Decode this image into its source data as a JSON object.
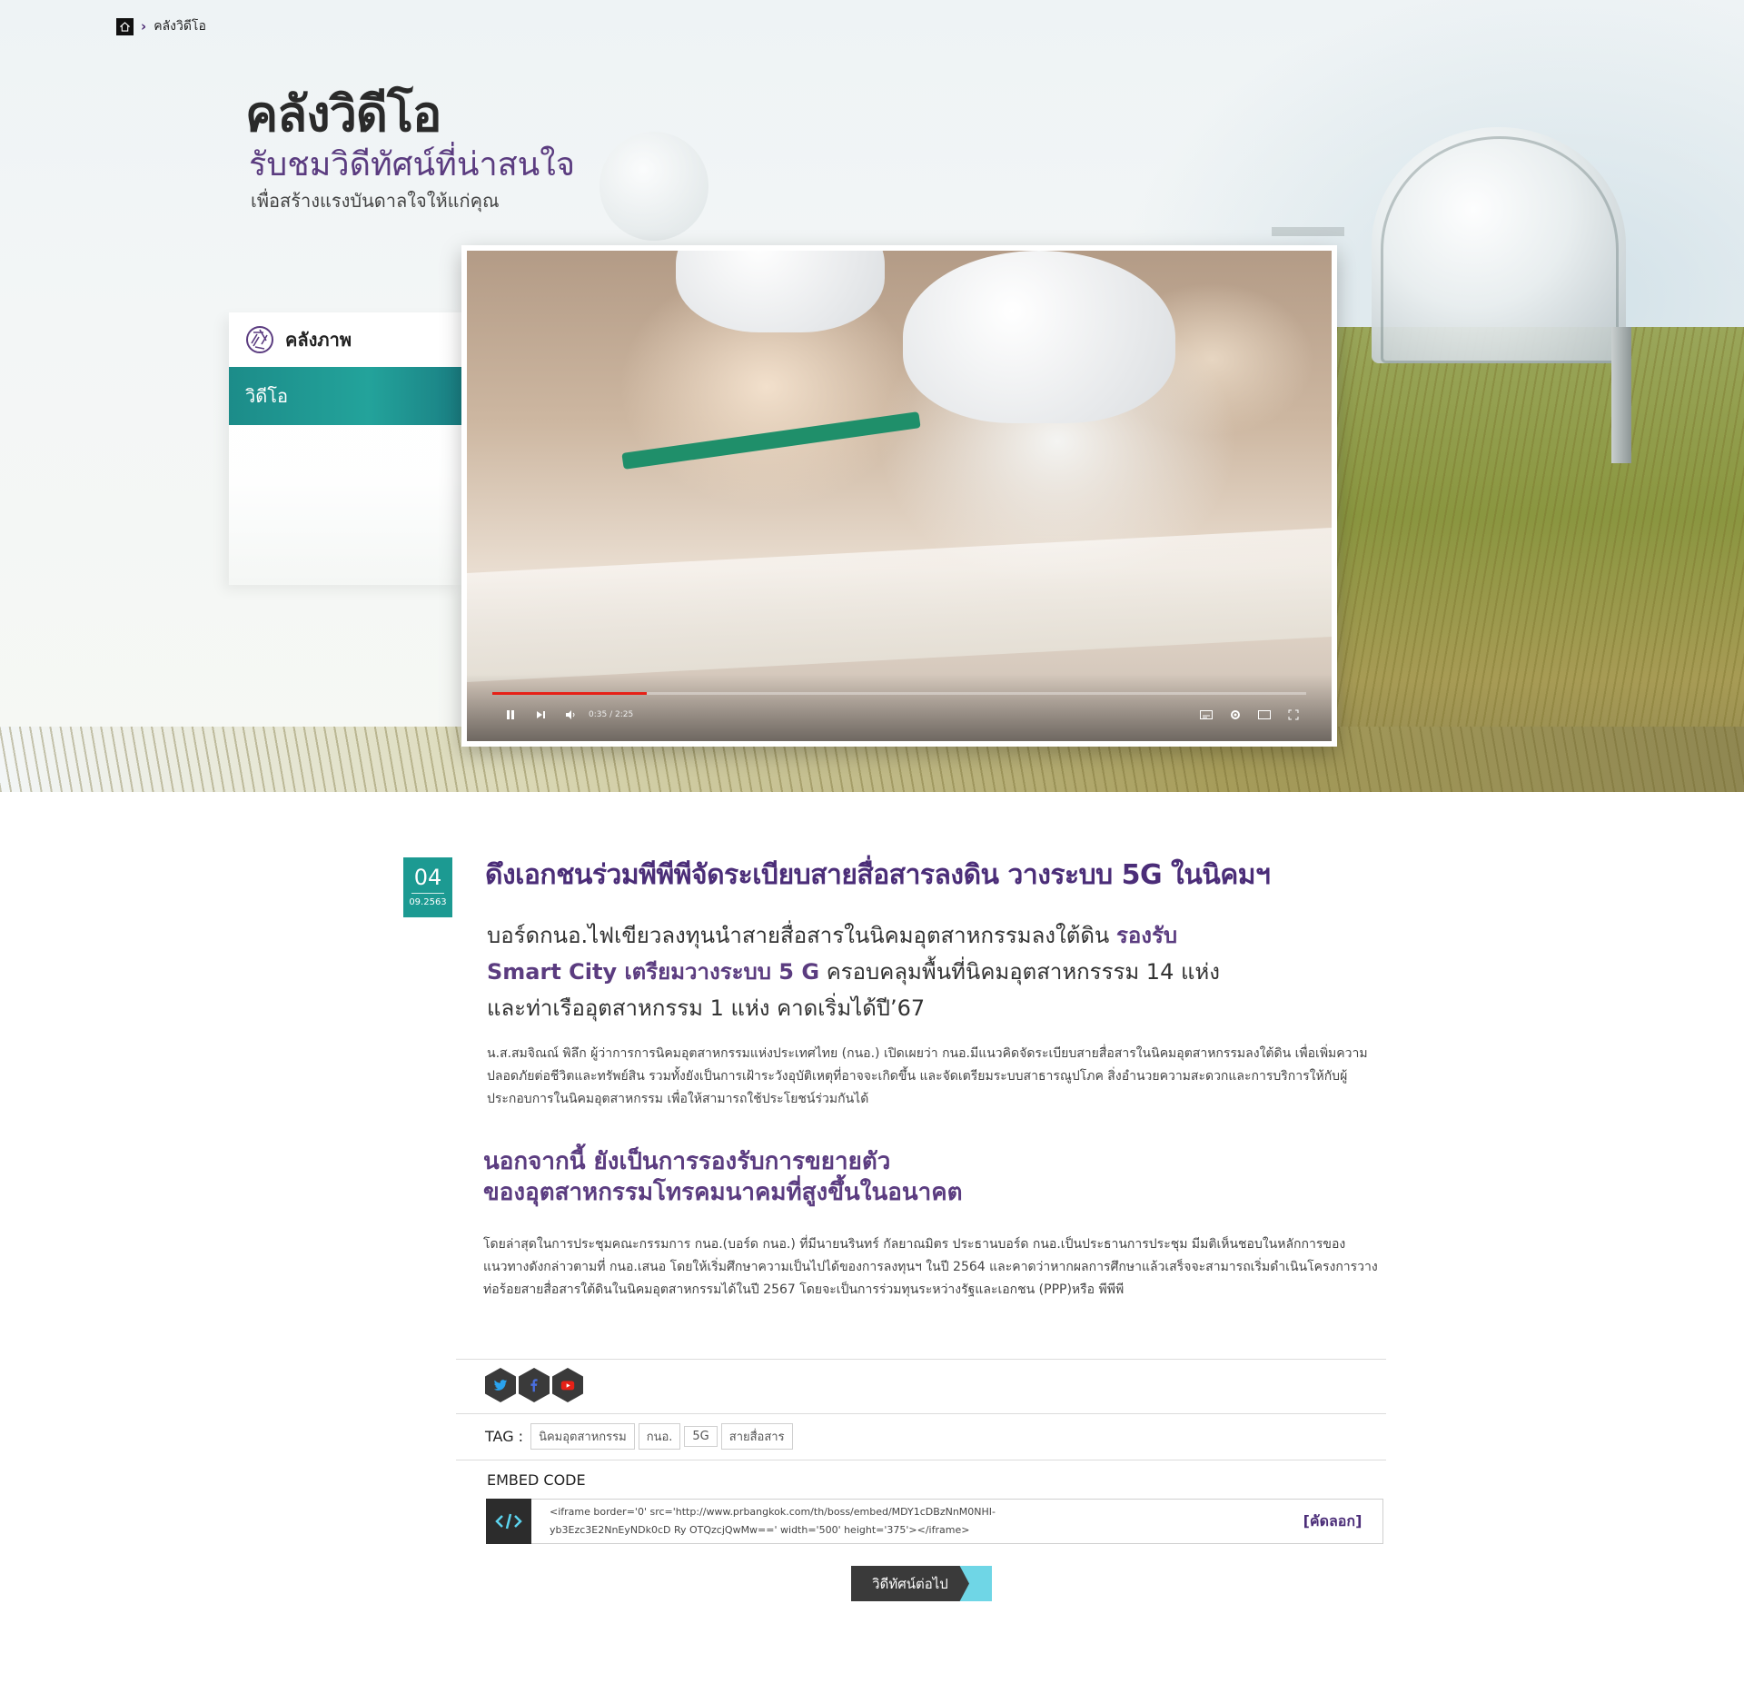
{
  "breadcrumb": {
    "current": "คลังวิดีโอ"
  },
  "header": {
    "title": "คลังวิดีโอ",
    "subtitle": "รับชมวิดีทัศน์ที่น่าสนใจ",
    "caption": "เพื่อสร้างแรงบันดาลใจให้แก่คุณ"
  },
  "sidebar": {
    "heading": "คลังภาพ",
    "items": [
      {
        "label": "วิดีโอ",
        "active": true
      }
    ]
  },
  "video": {
    "time": "0:35 / 2:25",
    "progress_fraction": 0.19,
    "icons": [
      "pause-icon",
      "next-icon",
      "volume-icon",
      "subtitles-icon",
      "settings-icon",
      "theater-icon",
      "fullscreen-icon"
    ]
  },
  "article": {
    "date_day": "04",
    "date_full": "09.2563",
    "headline": "ดึงเอกชนร่วมพีพีพีจัดระเบียบสายสื่อสารลงดิน วางระบบ 5G ในนิคมฯ",
    "lead_line1_a": "บอร์ดกนอ.ไฟเขียวลงทุนนำสายสื่อสารในนิคมอุตสาหกรรมลงใต้ดิน ",
    "lead_line1_b": "รองรับ",
    "lead_line2_a": "Smart City เตรียมวางระบบ 5 G",
    "lead_line2_b": " ครอบคลุมพื้นที่นิคมอุตสาหกรรรม 14 แห่ง",
    "lead_line3": "และท่าเรืออุตสาหกรรม 1 แห่ง คาดเริ่มได้ปี’67",
    "paragraph1": "น.ส.สมจิณณ์   พิลึก  ผู้ว่าการการนิคมอุตสาหกรรมแห่งประเทศไทย (กนอ.) เปิดเผยว่า  กนอ.มีแนวคิดจัดระเบียบสายสื่อสารในนิคมอุตสาหกรรมลงใต้ดิน เพื่อเพิ่มความปลอดภัยต่อชีวิตและทรัพย์สิน รวมทั้งยังเป็นการเฝ้าระวังอุบัติเหตุที่อาจจะเกิดขึ้น และจัดเตรียมระบบสาธารณูปโภค สิ่งอำนวยความสะดวกและการบริการให้กับผู้ประกอบการในนิคมอุตสาหกรรม เพื่อให้สามารถใช้ประโยชน์ร่วมกันได้",
    "subhead_line1": "นอกจากนี้ ยังเป็นการรองรับการขยายตัว",
    "subhead_line2": "ของอุตสาหกรรมโทรคมนาคมที่สูงขึ้นในอนาคต",
    "paragraph2": "โดยล่าสุดในการประชุมคณะกรรมการ กนอ.(บอร์ด กนอ.) ที่มีนายนรินทร์ กัลยาณมิตร ประธานบอร์ด กนอ.เป็นประธานการประชุม มีมติเห็นชอบในหลักการของแนวทางดังกล่าวตามที่ กนอ.เสนอ โดยให้เริ่มศึกษาความเป็นไปได้ของการลงทุนฯ ในปี 2564 และคาดว่าหากผลการศึกษาแล้วเสร็จจะสามารถเริ่มดำเนินโครงการวางท่อร้อยสายสื่อสารใต้ดินในนิคมอุตสาหกรรมได้ในปี 2567 โดยจะเป็นการร่วมทุนระหว่างรัฐและเอกชน (PPP)หรือ พีพีพี"
  },
  "share": {
    "icons": [
      "twitter-icon",
      "facebook-icon",
      "youtube-icon"
    ]
  },
  "tags": {
    "label": "TAG :",
    "items": [
      "นิคมอุตสาหกรรม",
      "กนอ.",
      "5G",
      "สายสื่อสาร"
    ]
  },
  "embed": {
    "label": "EMBED CODE",
    "code_line1": "<iframe border='0' src='http://www.prbangkok.com/th/boss/embed/MDY1cDBzNnM0NHI-",
    "code_line2": "yb3Ezc3E2NnEyNDk0cD Ry OTQzcjQwMw==' width='500' height='375'></iframe>",
    "copy_label": "[คัดลอก]"
  },
  "next_button": {
    "label": "วิดีทัศน์ต่อไป"
  },
  "colors": {
    "brand_purple": "#4b2d78",
    "teal": "#1c9a92",
    "accent_cyan": "#6fd6e6"
  }
}
